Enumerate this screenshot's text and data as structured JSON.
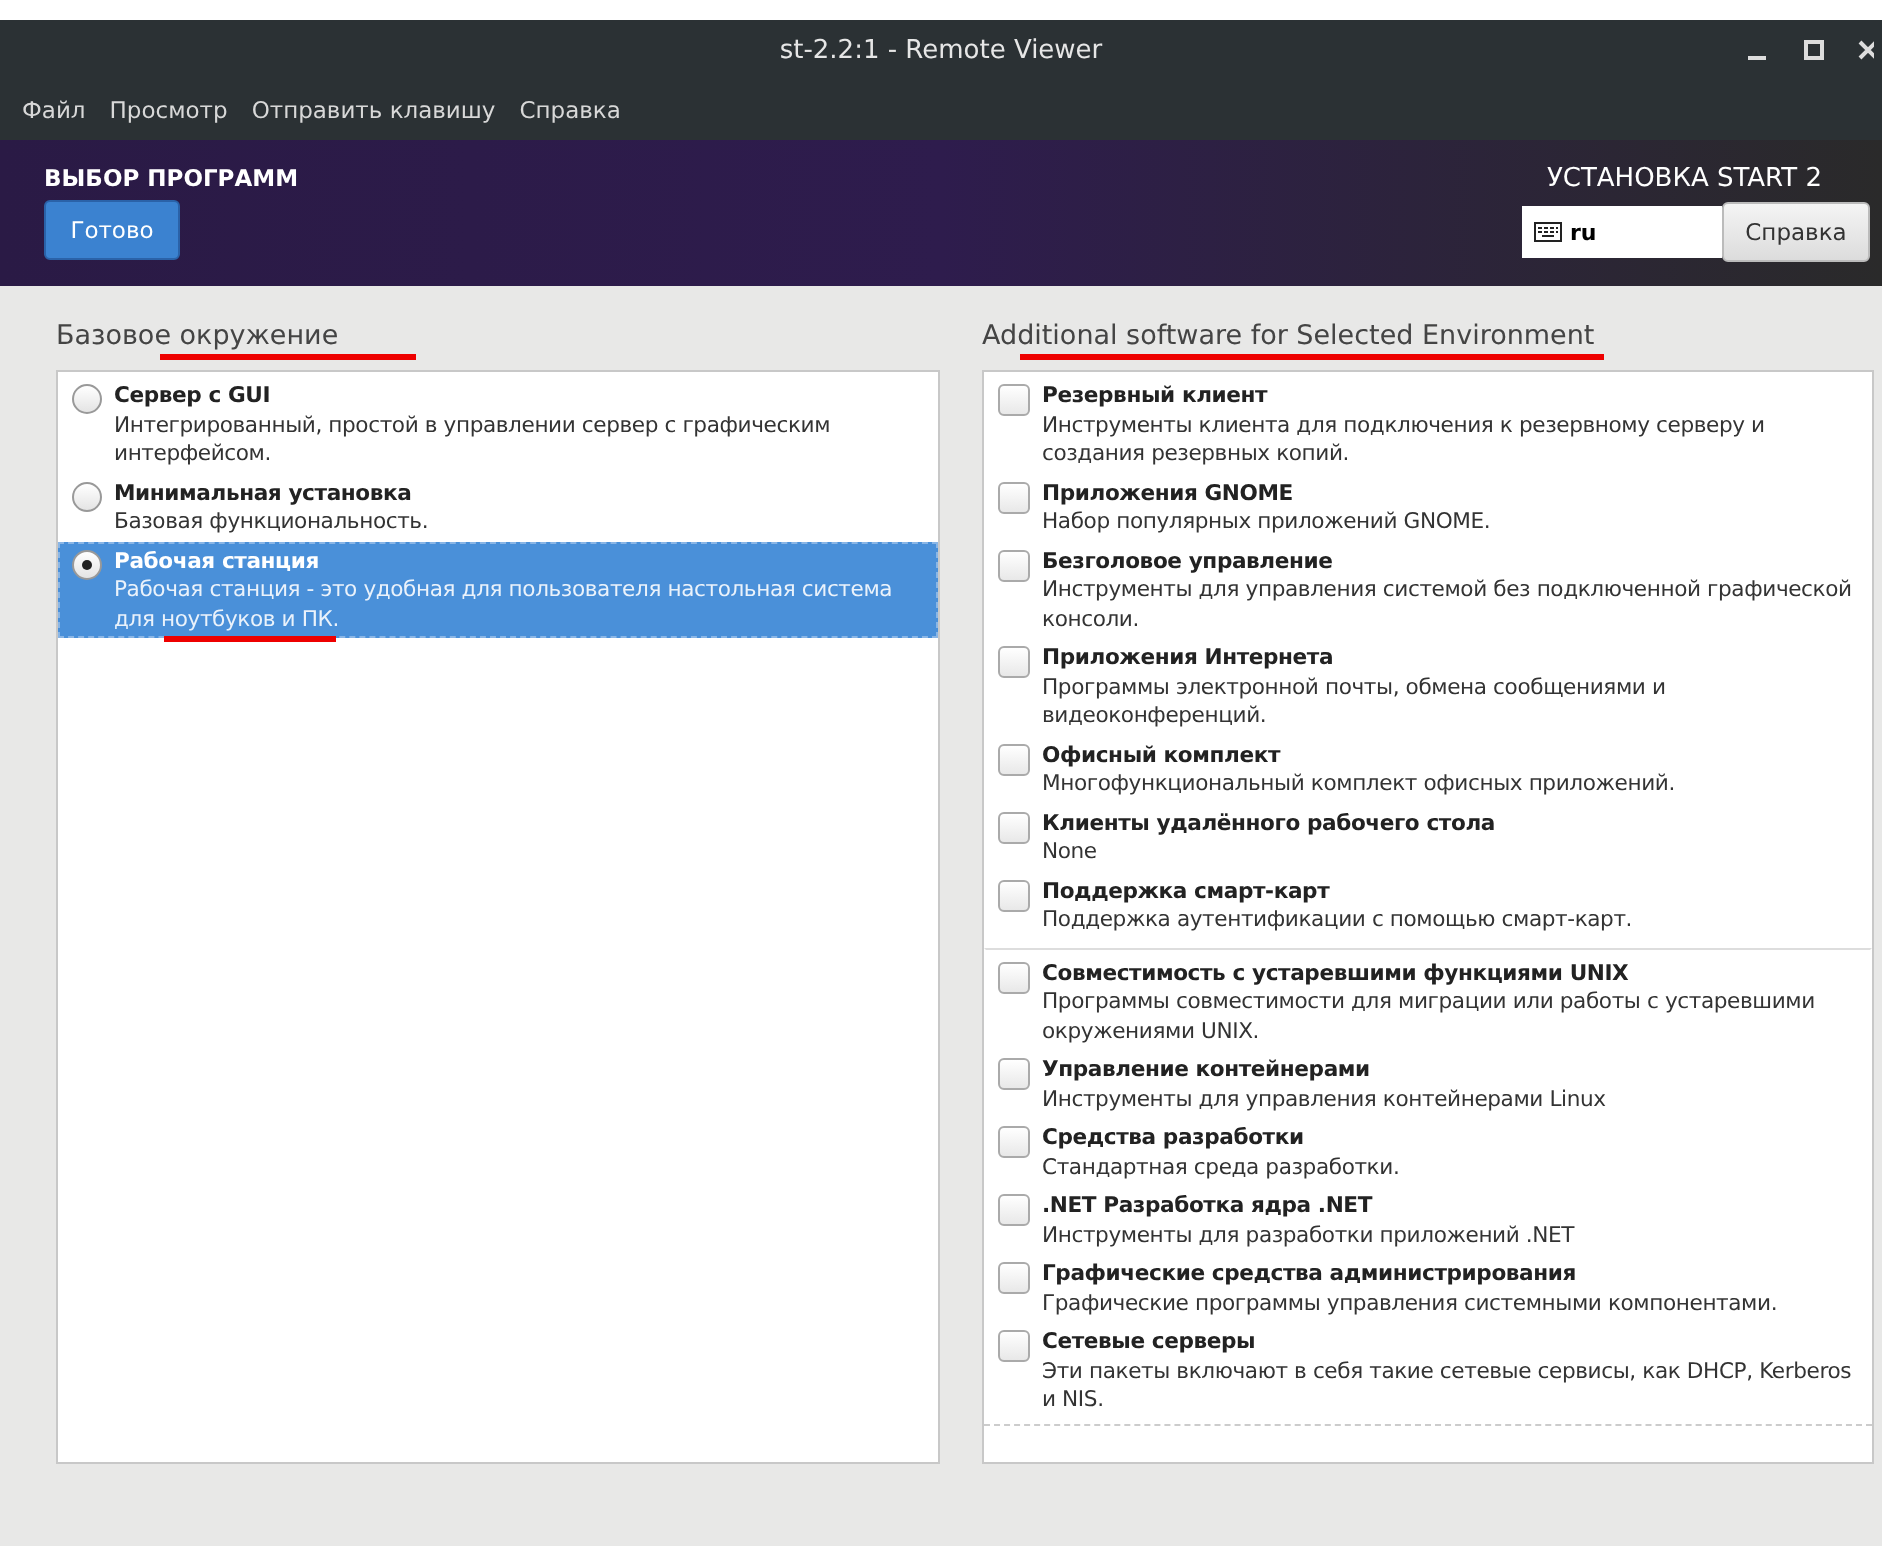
{
  "window": {
    "title": "st-2.2:1 - Remote Viewer"
  },
  "menu": [
    "Файл",
    "Просмотр",
    "Отправить клавишу",
    "Справка"
  ],
  "header": {
    "title": "ВЫБОР ПРОГРАММ",
    "done_button": "Готово",
    "product": "УСТАНОВКА START 2",
    "keyboard_layout": "ru",
    "help_button": "Справка"
  },
  "base_environment": {
    "heading": "Базовое окружение",
    "heading_underlined": true,
    "items": [
      {
        "name": "Сервер с GUI",
        "description": "Интегрированный, простой в управлении сервер с графическим интерфейсом.",
        "selected": false,
        "underlined": false
      },
      {
        "name": "Минимальная установка",
        "description": "Базовая функциональность.",
        "selected": false,
        "underlined": false
      },
      {
        "name": "Рабочая станция",
        "description": "Рабочая станция - это удобная для пользователя настольная система для ноутбуков и ПК.",
        "selected": true,
        "underlined": true
      }
    ]
  },
  "additional_software": {
    "heading": "Additional software for Selected Environment",
    "heading_underlined": true,
    "items": [
      {
        "name": "Резервный клиент",
        "description": "Инструменты клиента для подключения к резервному серверу и создания резервных копий.",
        "checked": false,
        "separator_before": false
      },
      {
        "name": "Приложения GNOME",
        "description": "Набор популярных приложений GNOME.",
        "checked": false,
        "separator_before": false
      },
      {
        "name": "Безголовое управление",
        "description": "Инструменты для управления системой без подключенной графической консоли.",
        "checked": false,
        "separator_before": false
      },
      {
        "name": "Приложения Интернета",
        "description": "Программы электронной почты, обмена сообщениями и видеоконференций.",
        "checked": false,
        "separator_before": false
      },
      {
        "name": "Офисный комплект",
        "description": "Многофункциональный комплект офисных приложений.",
        "checked": false,
        "separator_before": false
      },
      {
        "name": "Клиенты удалённого рабочего стола",
        "description": "None",
        "checked": false,
        "separator_before": false
      },
      {
        "name": "Поддержка смарт-карт",
        "description": "Поддержка аутентификации с помощью смарт-карт.",
        "checked": false,
        "separator_before": false
      },
      {
        "name": "Совместимость с устаревшими функциями UNIX",
        "description": "Программы совместимости для миграции или работы с устаревшими окружениями UNIX.",
        "checked": false,
        "separator_before": true
      },
      {
        "name": "Управление контейнерами",
        "description": "Инструменты для управления контейнерами Linux",
        "checked": false,
        "separator_before": false
      },
      {
        "name": "Средства разработки",
        "description": "Стандартная среда разработки.",
        "checked": false,
        "separator_before": false
      },
      {
        "name": ".NET Разработка ядра .NET",
        "description": "Инструменты для разработки приложений .NET",
        "checked": false,
        "separator_before": false
      },
      {
        "name": "Графические средства администрирования",
        "description": "Графические программы управления системными компонентами.",
        "checked": false,
        "separator_before": false
      },
      {
        "name": "Сетевые серверы",
        "description": "Эти пакеты включают в себя такие сетевые сервисы, как DHCP, Kerberos и NIS.",
        "checked": false,
        "separator_before": false
      }
    ]
  }
}
